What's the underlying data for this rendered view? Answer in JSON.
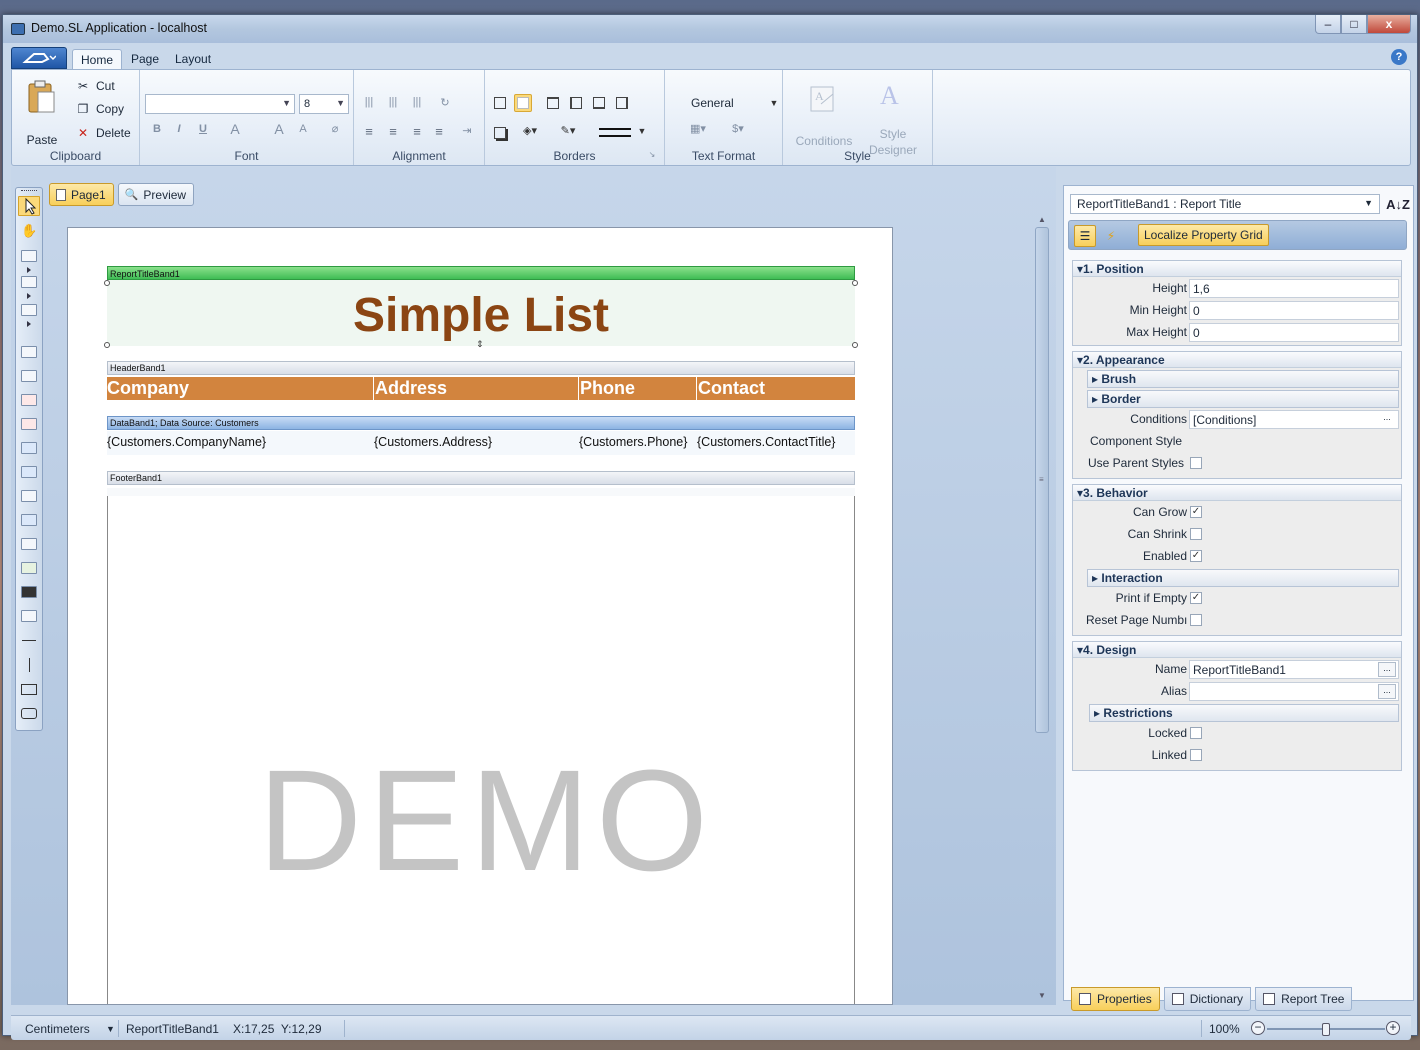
{
  "window": {
    "title": "Demo.SL Application - localhost",
    "buttons": {
      "minimize": "–",
      "maximize": "□",
      "close": "x"
    }
  },
  "ribbon": {
    "tabs": [
      "Home",
      "Page",
      "Layout"
    ],
    "active_tab": "Home",
    "help": "?",
    "clipboard": {
      "label": "Clipboard",
      "paste": "Paste",
      "cut": "Cut",
      "copy": "Copy",
      "delete": "Delete"
    },
    "font": {
      "label": "Font",
      "family": "",
      "size": "8"
    },
    "alignment": {
      "label": "Alignment"
    },
    "borders": {
      "label": "Borders"
    },
    "text_format": {
      "label": "Text Format",
      "format": "General"
    },
    "style": {
      "label": "Style",
      "conditions": "Conditions",
      "style_designer_1": "Style",
      "style_designer_2": "Designer"
    }
  },
  "designer": {
    "page_tabs": [
      {
        "label": "Page1",
        "active": true
      },
      {
        "label": "Preview",
        "active": false
      }
    ],
    "report": {
      "title_band": "ReportTitleBand1",
      "title_text": "Simple List",
      "header_band": "HeaderBand1",
      "columns": [
        "Company",
        "Address",
        "Phone",
        "Contact"
      ],
      "data_band": "DataBand1; Data Source: Customers",
      "fields": [
        "{Customers.CompanyName}",
        "{Customers.Address}",
        "{Customers.Phone}",
        "{Customers.ContactTitle}"
      ],
      "footer_band": "FooterBand1",
      "watermark": "DEMO"
    }
  },
  "properties": {
    "selected_object": "ReportTitleBand1 : Report Title",
    "sort_icon": "A↓Z",
    "localize_button": "Localize Property Grid",
    "categories": {
      "position": {
        "title": "1. Position",
        "rows": [
          {
            "name": "Height",
            "value": "1,6"
          },
          {
            "name": "Min Height",
            "value": "0"
          },
          {
            "name": "Max Height",
            "value": "0"
          }
        ]
      },
      "appearance": {
        "title": "2. Appearance",
        "brush": "Brush",
        "border": "Border",
        "conditions_name": "Conditions",
        "conditions_value": "[Conditions]",
        "component_style": "Component Style",
        "use_parent_styles": "Use Parent Styles"
      },
      "behavior": {
        "title": "3. Behavior",
        "can_grow": "Can Grow",
        "can_shrink": "Can Shrink",
        "enabled": "Enabled",
        "interaction": "Interaction",
        "print_if_empty": "Print if Empty",
        "reset_page_number": "Reset Page Numbı"
      },
      "design": {
        "title": "4. Design",
        "name_label": "Name",
        "name_value": "ReportTitleBand1",
        "alias_label": "Alias",
        "alias_value": "",
        "restrictions": "Restrictions",
        "locked": "Locked",
        "linked": "Linked"
      }
    },
    "check_mark": "✓",
    "dots": "...",
    "bottom_tabs": [
      {
        "label": "Properties",
        "active": true
      },
      {
        "label": "Dictionary",
        "active": false
      },
      {
        "label": "Report Tree",
        "active": false
      }
    ]
  },
  "statusbar": {
    "units": "Centimeters",
    "selected": "ReportTitleBand1",
    "coords": "X:17,25  Y:12,29",
    "zoom": "100%",
    "zoom_minus": "−",
    "zoom_plus": "+",
    "zoom_level": 0.5
  }
}
